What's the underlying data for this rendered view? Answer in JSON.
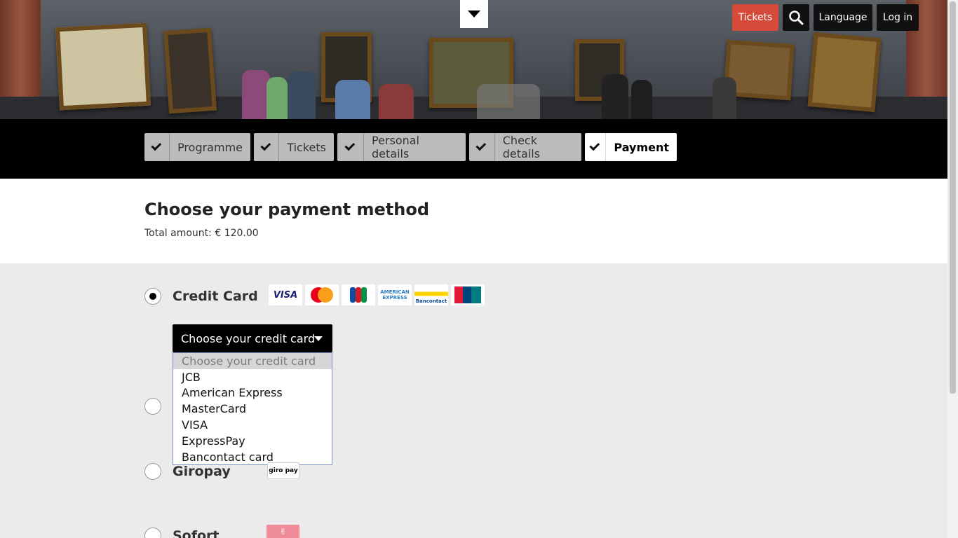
{
  "header": {
    "tickets_label": "Tickets",
    "language_label": "Language",
    "login_label": "Log in"
  },
  "steps": [
    {
      "label": "Programme"
    },
    {
      "label": "Tickets"
    },
    {
      "label": "Personal details"
    },
    {
      "label": "Check details"
    },
    {
      "label": "Payment"
    }
  ],
  "main": {
    "title": "Choose your payment method",
    "total": "Total amount: € 120.00"
  },
  "methods": {
    "credit_card": "Credit Card",
    "giropay": "Giropay",
    "sofort": "Sofort"
  },
  "card_logos": [
    "VISA",
    "MasterCard",
    "JCB",
    "AMERICAN EXPRESS",
    "Bancontact",
    "UnionPay"
  ],
  "giro_logo": "giro pay",
  "credit_select": {
    "selected": "Choose your credit card",
    "options": [
      "Choose your credit card",
      "JCB",
      "American Express",
      "MasterCard",
      "VISA",
      "ExpressPay",
      "Bancontact card"
    ]
  },
  "colors": {
    "accent": "#d64a3a",
    "steps_bg": "#000000",
    "step_done": "#bcbcbc",
    "grey_area": "#ebebeb"
  }
}
